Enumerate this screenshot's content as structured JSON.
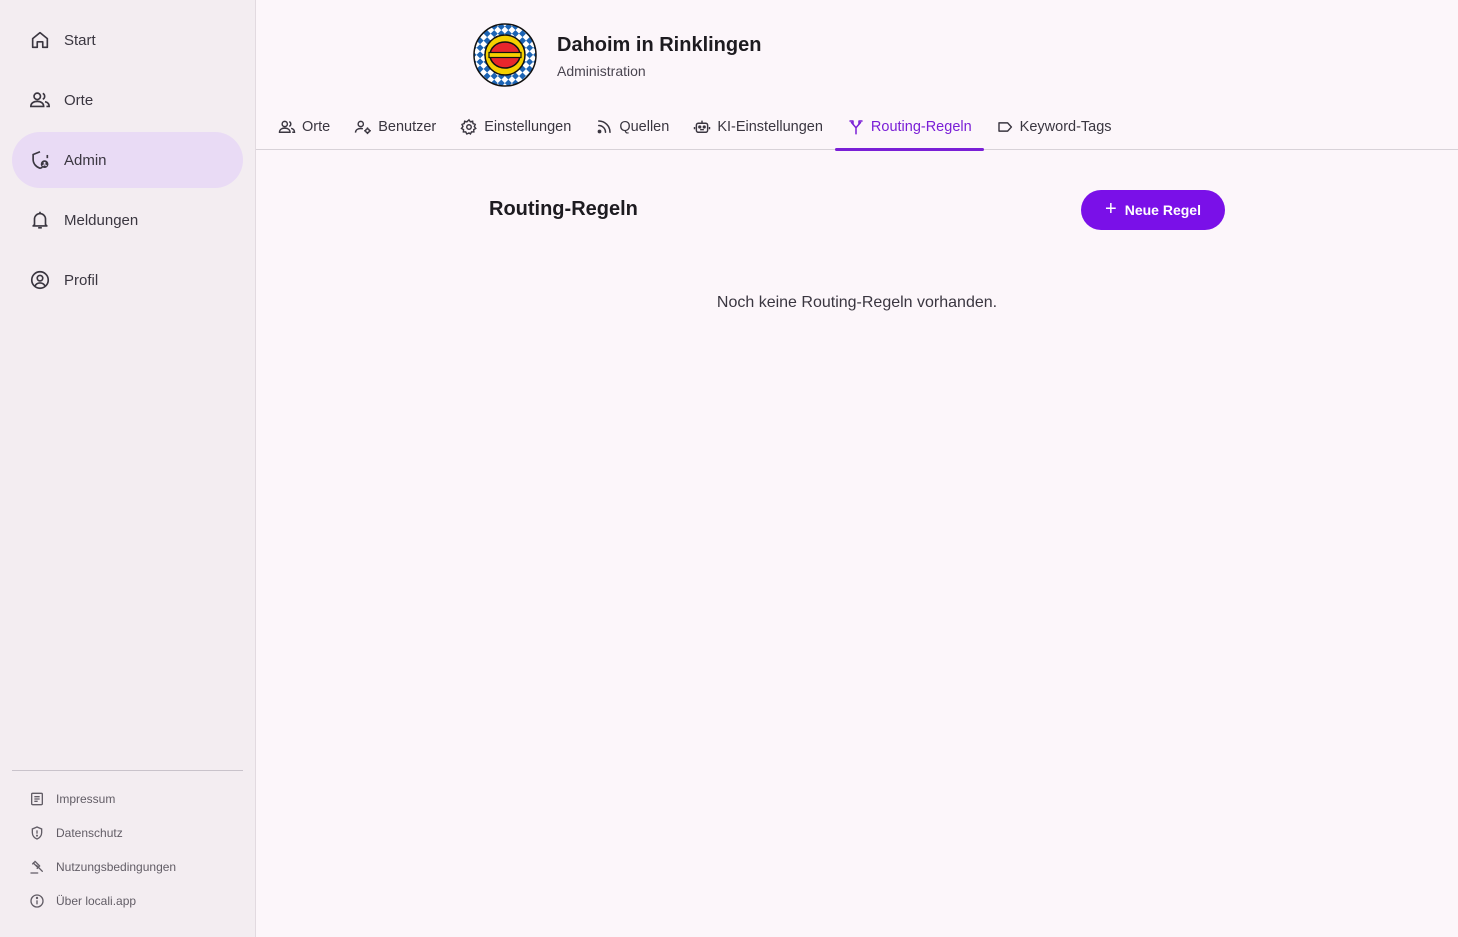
{
  "sidebar": {
    "items": [
      {
        "label": "Start",
        "icon": "home-icon"
      },
      {
        "label": "Orte",
        "icon": "users-icon"
      },
      {
        "label": "Admin",
        "icon": "shield-user-icon"
      },
      {
        "label": "Meldungen",
        "icon": "bell-icon"
      },
      {
        "label": "Profil",
        "icon": "user-circle-icon"
      }
    ],
    "footer": [
      {
        "label": "Impressum",
        "icon": "document-icon"
      },
      {
        "label": "Datenschutz",
        "icon": "shield-icon"
      },
      {
        "label": "Nutzungsbedingungen",
        "icon": "gavel-icon"
      },
      {
        "label": "Über locali.app",
        "icon": "info-icon"
      }
    ]
  },
  "header": {
    "title": "Dahoim in Rinklingen",
    "subtitle": "Administration"
  },
  "tabs": [
    {
      "label": "Orte",
      "icon": "users-icon"
    },
    {
      "label": "Benutzer",
      "icon": "user-cog-icon"
    },
    {
      "label": "Einstellungen",
      "icon": "gear-icon"
    },
    {
      "label": "Quellen",
      "icon": "rss-icon"
    },
    {
      "label": "KI-Einstellungen",
      "icon": "robot-icon"
    },
    {
      "label": "Routing-Regeln",
      "icon": "fork-icon"
    },
    {
      "label": "Keyword-Tags",
      "icon": "tag-icon"
    }
  ],
  "main": {
    "title": "Routing-Regeln",
    "new_button": "Neue Regel",
    "empty_message": "Noch keine Routing-Regeln vorhanden."
  },
  "colors": {
    "accent": "#7a10e8",
    "active_nav": "#e9dbf5",
    "sidebar_bg": "#f3edf1",
    "page_bg": "#fcf6fa"
  }
}
